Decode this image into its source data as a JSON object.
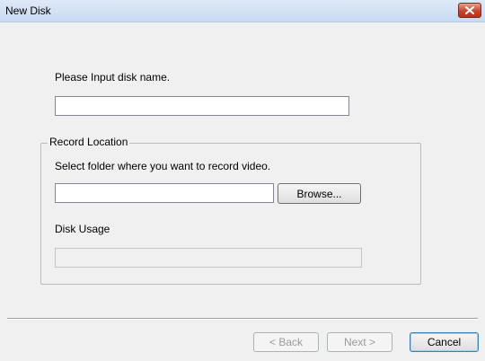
{
  "window": {
    "title": "New Disk",
    "close_icon": "close-icon",
    "colors": {
      "title_bar": "#c9dbf1",
      "close_button": "#c7452f",
      "background": "#f0f0f0"
    }
  },
  "disk_name": {
    "prompt": "Please Input disk name.",
    "value": ""
  },
  "record_location": {
    "group_label": "Record Location",
    "folder_prompt": "Select folder where you want to record video.",
    "folder_value": "",
    "browse_label": "Browse...",
    "disk_usage_label": "Disk Usage",
    "disk_usage_value": ""
  },
  "footer": {
    "back_label": "< Back",
    "next_label": "Next >",
    "cancel_label": "Cancel"
  }
}
